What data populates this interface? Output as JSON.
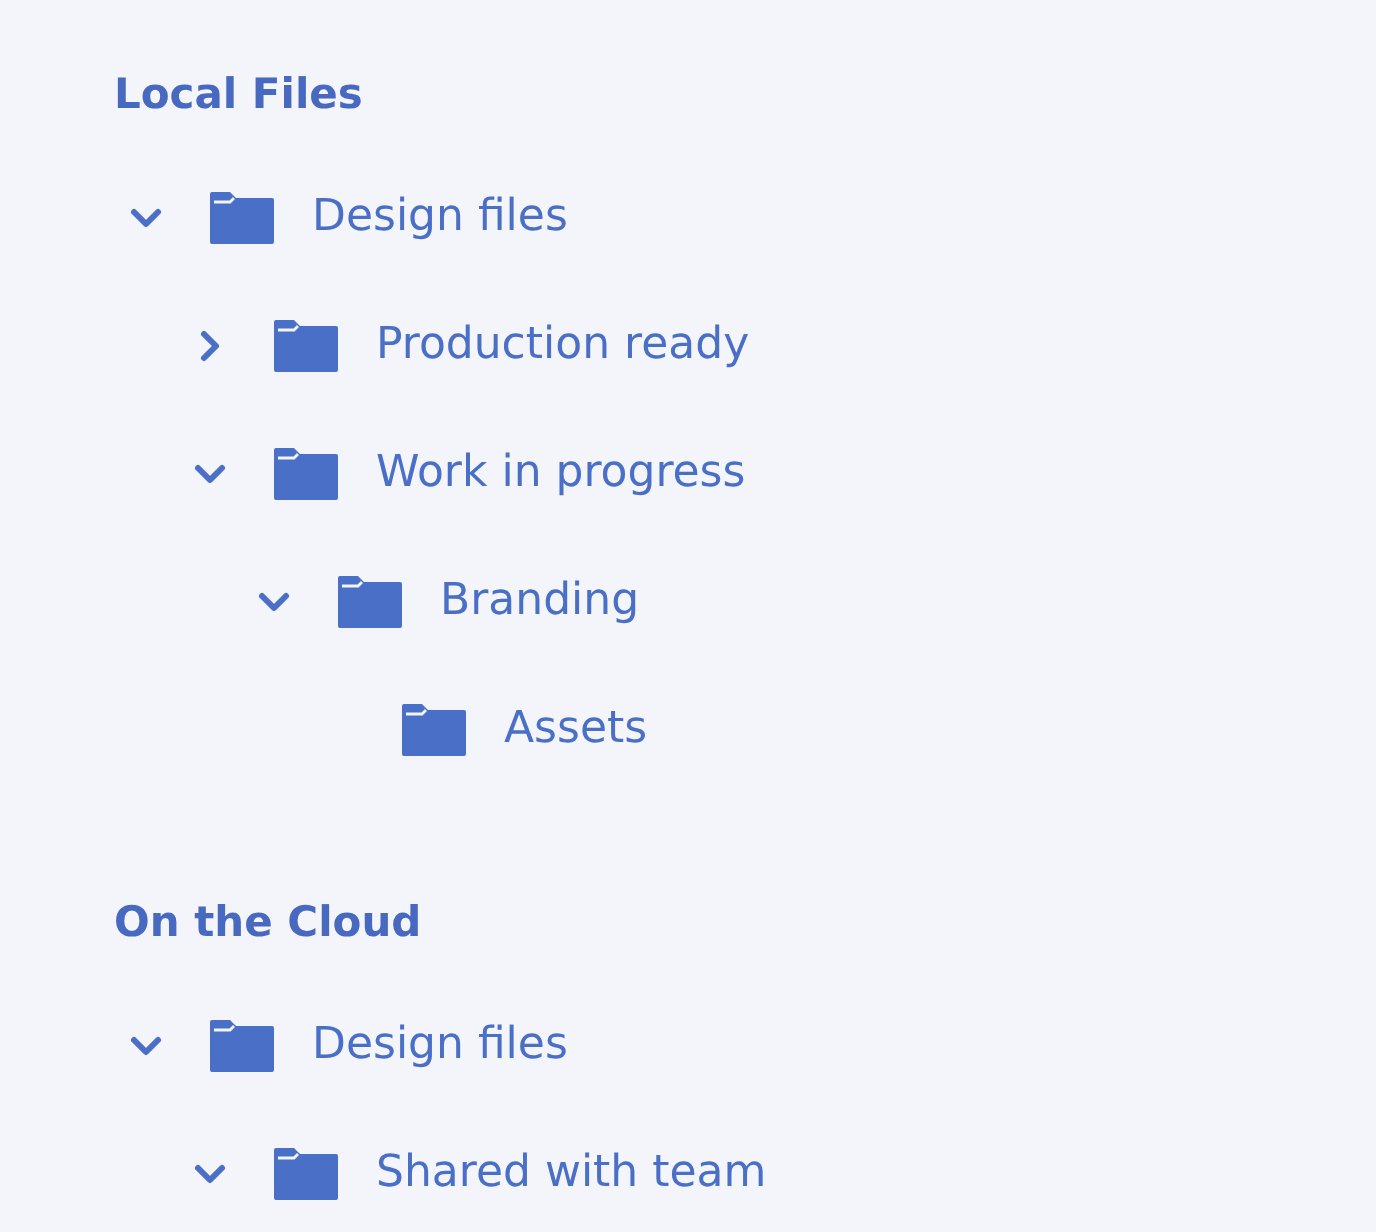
{
  "sections": [
    {
      "title": "Local Files",
      "items": [
        {
          "label": "Design files",
          "expanded": true,
          "children": [
            {
              "label": "Production ready",
              "expanded": false
            },
            {
              "label": "Work in progress",
              "expanded": true,
              "children": [
                {
                  "label": "Branding",
                  "expanded": true,
                  "children": [
                    {
                      "label": "Assets"
                    }
                  ]
                }
              ]
            }
          ]
        }
      ]
    },
    {
      "title": "On the Cloud",
      "items": [
        {
          "label": "Design files",
          "expanded": true,
          "children": [
            {
              "label": "Shared with team",
              "expanded": true
            }
          ]
        }
      ]
    }
  ]
}
